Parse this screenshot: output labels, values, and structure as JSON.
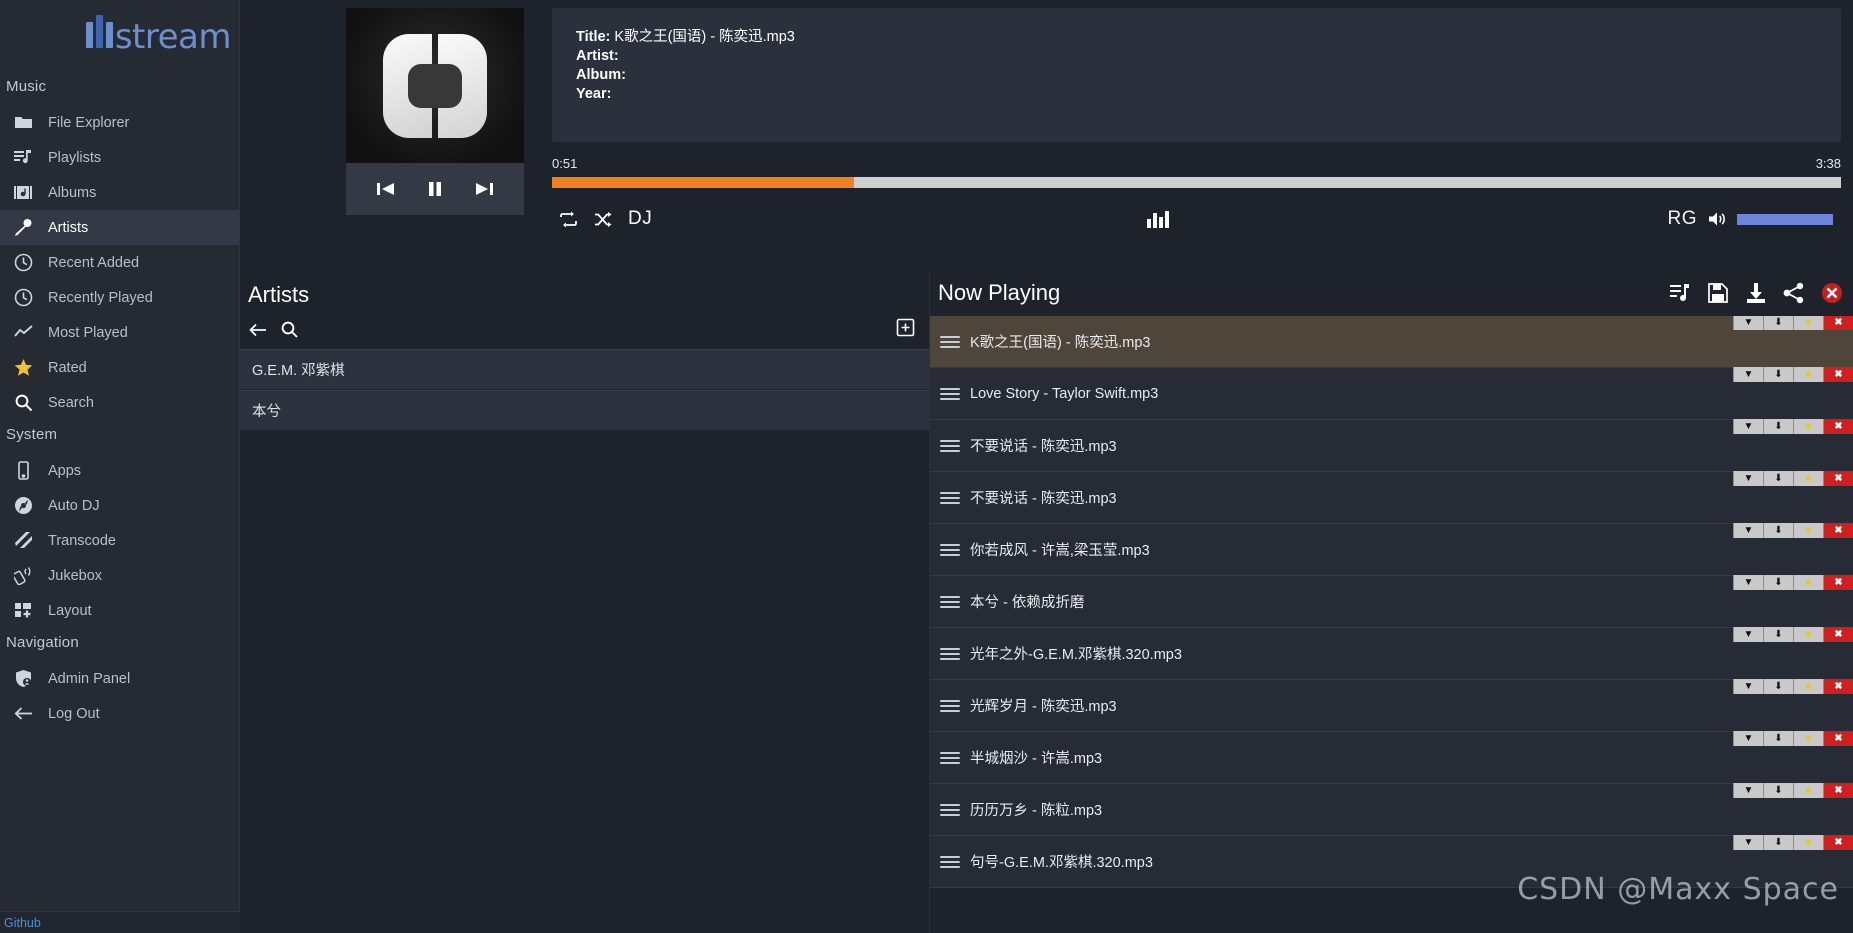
{
  "brand": {
    "name": "stream",
    "logo_icon": "mstream-logo-icon"
  },
  "sidebar": {
    "sections": [
      {
        "label": "Music",
        "items": [
          {
            "label": "File Explorer",
            "icon": "folder-icon",
            "active": false
          },
          {
            "label": "Playlists",
            "icon": "playlist-icon",
            "active": false
          },
          {
            "label": "Albums",
            "icon": "albums-icon",
            "active": false
          },
          {
            "label": "Artists",
            "icon": "microphone-icon",
            "active": true
          },
          {
            "label": "Recent Added",
            "icon": "clock-icon",
            "active": false
          },
          {
            "label": "Recently Played",
            "icon": "clock-icon",
            "active": false
          },
          {
            "label": "Most Played",
            "icon": "chart-line-icon",
            "active": false
          },
          {
            "label": "Rated",
            "icon": "star-icon",
            "active": false
          },
          {
            "label": "Search",
            "icon": "search-icon",
            "active": false
          }
        ]
      },
      {
        "label": "System",
        "items": [
          {
            "label": "Apps",
            "icon": "phone-icon",
            "active": false
          },
          {
            "label": "Auto DJ",
            "icon": "disc-icon",
            "active": false
          },
          {
            "label": "Transcode",
            "icon": "transcode-icon",
            "active": false
          },
          {
            "label": "Jukebox",
            "icon": "remote-icon",
            "active": false
          },
          {
            "label": "Layout",
            "icon": "layout-icon",
            "active": false
          }
        ]
      },
      {
        "label": "Navigation",
        "items": [
          {
            "label": "Admin Panel",
            "icon": "shield-user-icon",
            "active": false
          },
          {
            "label": "Log Out",
            "icon": "arrow-left-icon",
            "active": false
          }
        ]
      }
    ]
  },
  "status_bar": {
    "link_label": "Github"
  },
  "player": {
    "album_art_icon": "mstream-placeholder-art",
    "transport": {
      "previous_label": "previous-track",
      "pause_label": "pause",
      "next_label": "next-track"
    },
    "metadata": {
      "title_label": "Title:",
      "title_value": "K歌之王(国语) - 陈奕迅.mp3",
      "artist_label": "Artist:",
      "artist_value": "",
      "album_label": "Album:",
      "album_value": "",
      "year_label": "Year:",
      "year_value": ""
    },
    "seek": {
      "current_time": "0:51",
      "total_time": "3:38",
      "progress_percent": 23.4,
      "fill_color": "#f08022",
      "track_color": "#cfcfcf"
    },
    "controls": {
      "repeat_icon": "repeat-icon",
      "shuffle_icon": "shuffle-icon",
      "dj_label": "DJ",
      "equalizer_icon": "equalizer-icon",
      "rg_label": "RG",
      "volume_icon": "speaker-icon",
      "volume_percent": 100,
      "volume_color": "#6d83dc"
    }
  },
  "artists_pane": {
    "title": "Artists",
    "back_icon": "arrow-left-icon",
    "search_icon": "search-icon",
    "add_icon": "add-box-icon",
    "items": [
      {
        "label": "G.E.M. 邓紫棋"
      },
      {
        "label": "本兮"
      }
    ]
  },
  "now_playing": {
    "title": "Now Playing",
    "header_icons": [
      {
        "name": "add-to-playlist-icon"
      },
      {
        "name": "save-icon"
      },
      {
        "name": "download-icon"
      },
      {
        "name": "share-icon"
      },
      {
        "name": "clear-playlist-icon"
      }
    ],
    "row_actions": [
      {
        "name": "dropdown-icon",
        "glyph": "▼"
      },
      {
        "name": "download-icon",
        "glyph": "⬇"
      },
      {
        "name": "star-icon",
        "glyph": "★"
      },
      {
        "name": "remove-icon",
        "glyph": "✖"
      }
    ],
    "tracks": [
      {
        "title": "K歌之王(国语) - 陈奕迅.mp3",
        "playing": true
      },
      {
        "title": "Love Story - Taylor Swift.mp3",
        "playing": false
      },
      {
        "title": "不要说话 - 陈奕迅.mp3",
        "playing": false
      },
      {
        "title": "不要说话 - 陈奕迅.mp3",
        "playing": false
      },
      {
        "title": "你若成风 - 许嵩,梁玉莹.mp3",
        "playing": false
      },
      {
        "title": "本兮 - 依赖成折磨",
        "playing": false
      },
      {
        "title": "光年之外-G.E.M.邓紫棋.320.mp3",
        "playing": false
      },
      {
        "title": "光辉岁月 - 陈奕迅.mp3",
        "playing": false
      },
      {
        "title": "半城烟沙 - 许嵩.mp3",
        "playing": false
      },
      {
        "title": "历历万乡 - 陈粒.mp3",
        "playing": false
      },
      {
        "title": "句号-G.E.M.邓紫棋.320.mp3",
        "playing": false
      }
    ]
  },
  "watermark": {
    "text": "CSDN @Maxx Space"
  }
}
